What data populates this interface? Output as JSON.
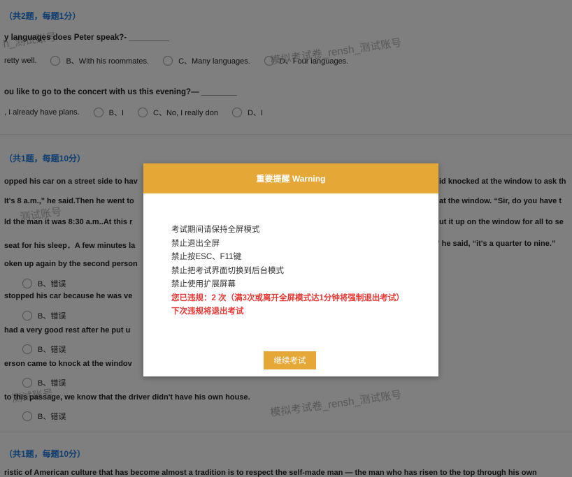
{
  "sections": {
    "s1_title": "（共2题，每题1分）",
    "s2_title": "（共1题，每题10分）",
    "s3_title": "（共1题，每题10分）"
  },
  "q1": {
    "question": "y languages does Peter speak?- _________",
    "options": [
      "retty well.",
      "B、With his roommates.",
      "C、Many languages.",
      "D、Four languages."
    ]
  },
  "q2": {
    "question": "ou like to go to the concert with us this evening?— ________",
    "options": [
      ", I already have plans.",
      "B、I",
      "C、No, I really don",
      "D、I"
    ]
  },
  "passage": {
    "left_lines": [
      "opped his car on a street side to hav",
      "It's 8 a.m.,\" he said.Then he went to",
      "ld the man it was 8:30 a.m..At this r",
      "seat for his sleep．A few minutes la",
      "oken up again by the second person"
    ],
    "right_lines": [
      "id knocked at the window to ask th",
      "at the window.  “Sir, do you have t",
      "ut it up on the window for all to se",
      ",” he said, “it's a quarter to nine.”"
    ]
  },
  "tf": {
    "option_label": "B、错误",
    "statements": [
      "stopped his car because he was ve",
      "had a very good rest after he put u",
      "erson came to knock at the windov",
      "to this passage, we know that the driver didn't have his own house."
    ]
  },
  "s3_passage": "ristic of American culture that has become almost a tradition is to respect the self-made man — the man who has risen to the top through his own",
  "watermarks": {
    "a": "模拟考试卷_rensh_测试账号",
    "b": "h_测试账号",
    "c": "测试账号"
  },
  "modal": {
    "title": "重要提醒 Warning",
    "rules": [
      "考试期间请保持全屏模式",
      "禁止退出全屏",
      "禁止按ESC、F11键",
      "禁止把考试界面切换到后台模式",
      "禁止使用扩展屏幕"
    ],
    "violation": "您已违规：2 次（满3次或离开全屏模式达1分钟将强制退出考试）",
    "next_warning": "下次违规将退出考试",
    "continue_label": "继续考试"
  },
  "colors": {
    "accent": "#e5a735",
    "section_blue": "#1e7be0",
    "warn_red": "#e53935"
  }
}
